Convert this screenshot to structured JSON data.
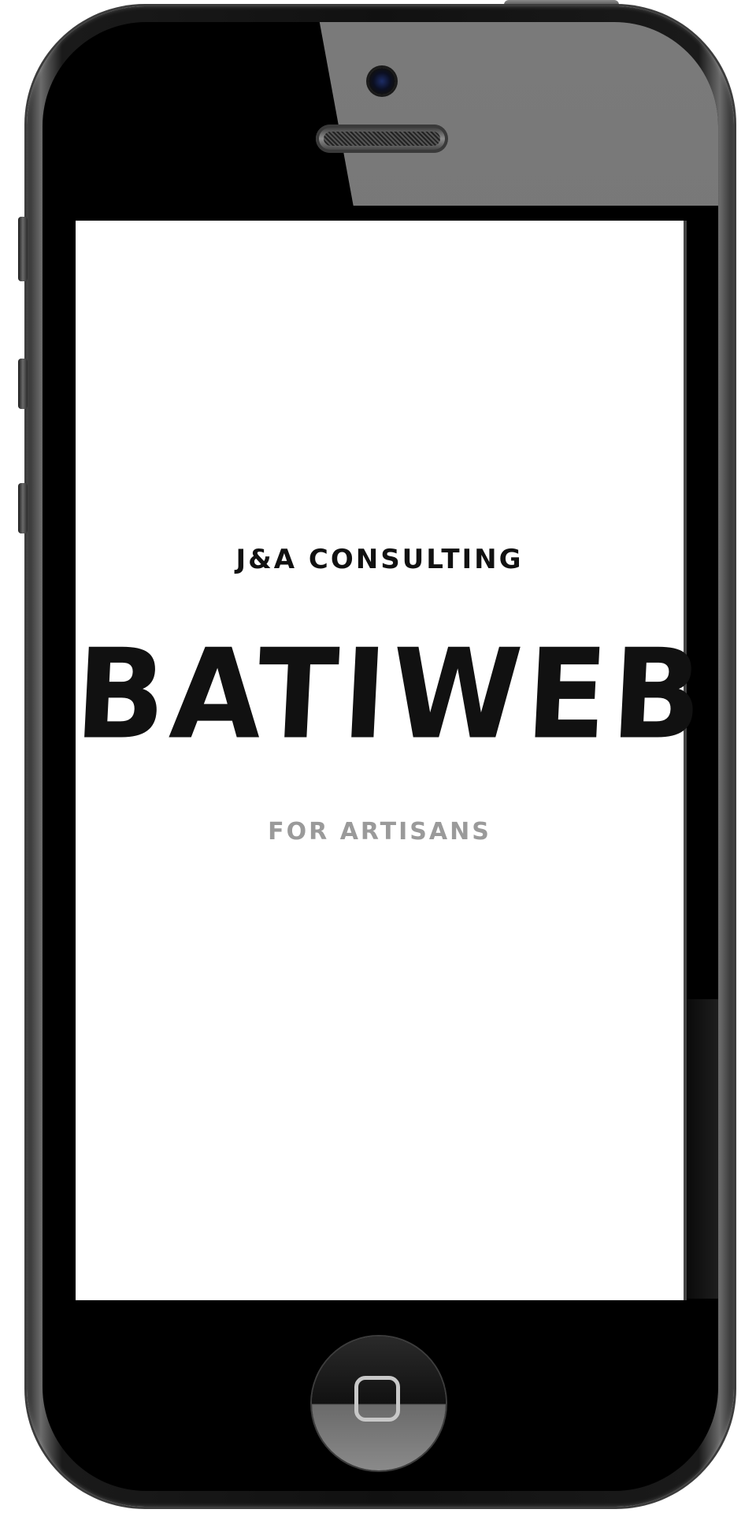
{
  "screen": {
    "company": "J&A CONSULTING",
    "brand": "BATIWEB",
    "tagline": "FOR ARTISANS"
  },
  "colors": {
    "screen_background": "#ffffff",
    "primary_text": "#111111",
    "tagline_text": "#9a9a9a",
    "device_frame": "#111111"
  },
  "icons": {
    "home": "home-square-icon",
    "camera": "front-camera-icon",
    "speaker": "earpiece-speaker-icon"
  }
}
